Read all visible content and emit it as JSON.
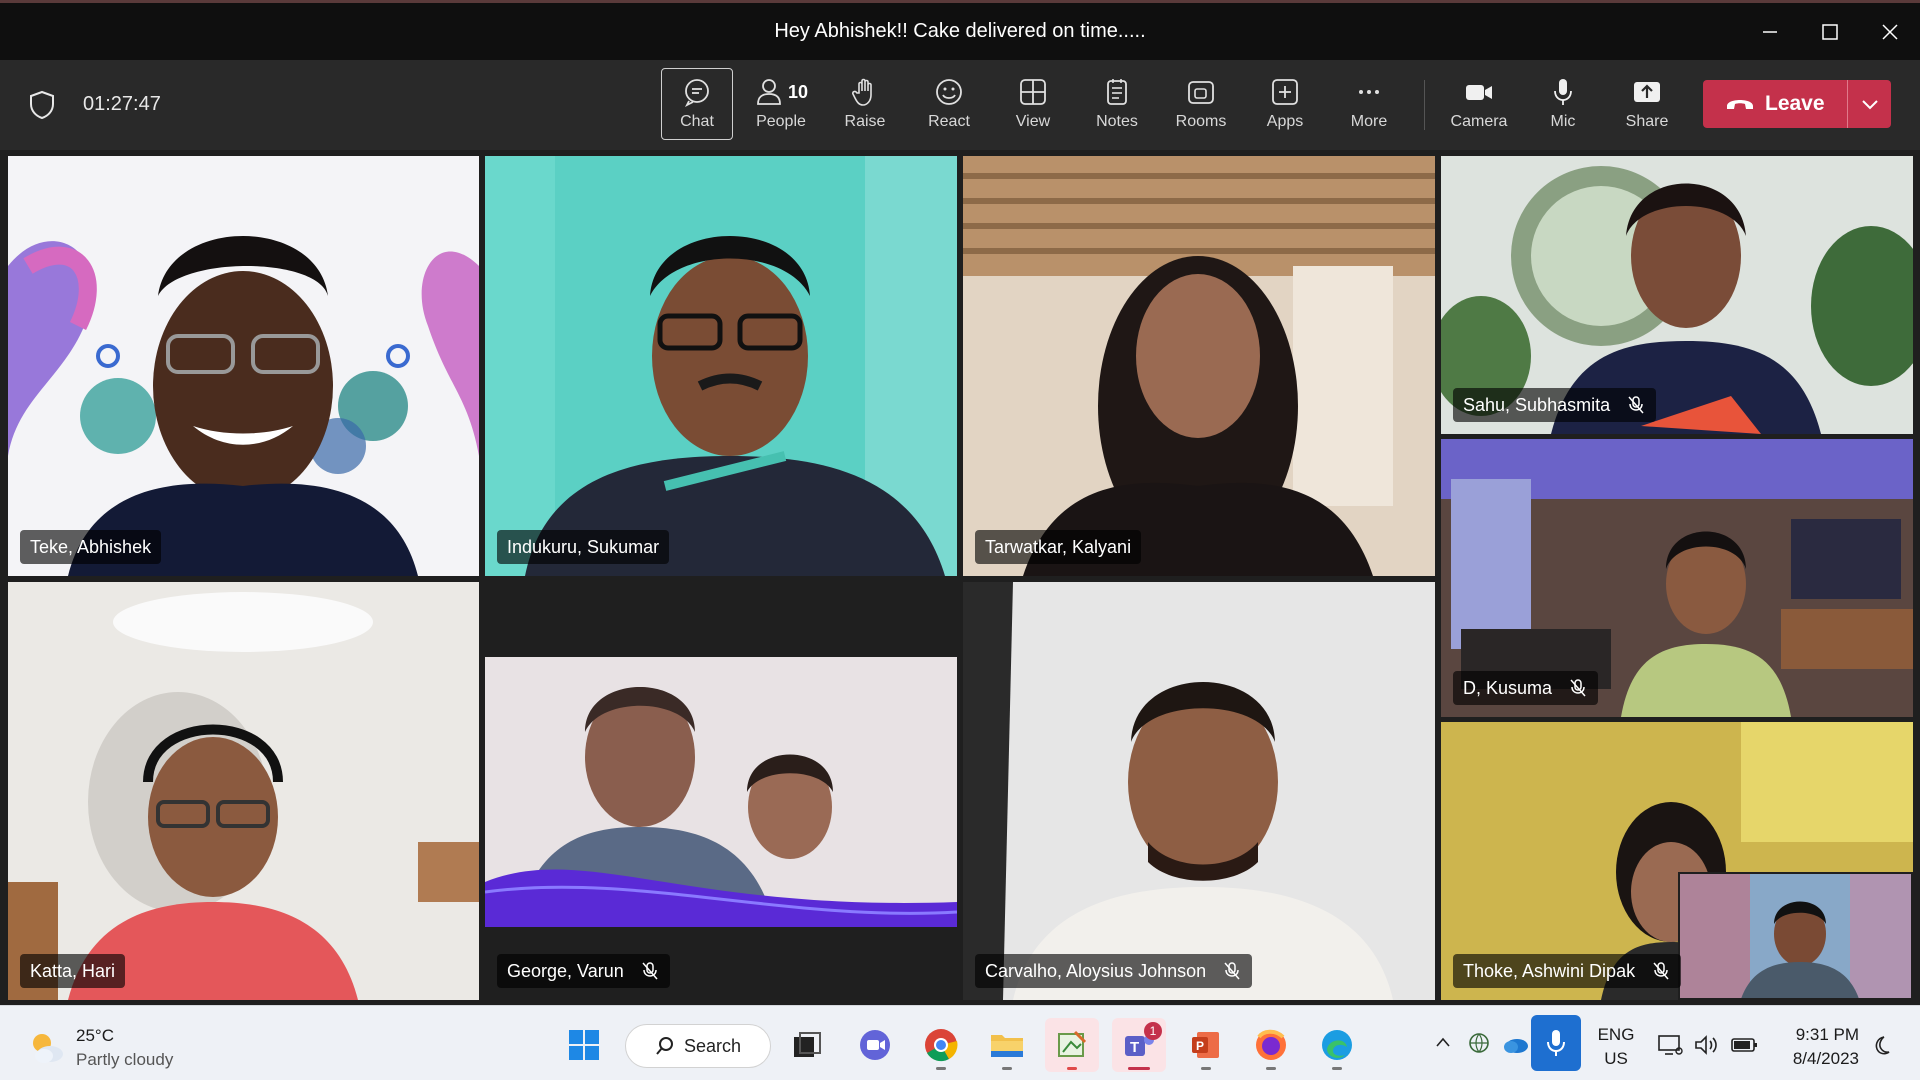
{
  "window": {
    "title": "Hey Abhishek!! Cake delivered on time.....",
    "controls": [
      "minimize-icon",
      "maximize-icon",
      "close-icon"
    ]
  },
  "toolbar": {
    "timer": "01:27:47",
    "tools": [
      {
        "label": "Chat",
        "icon": "chat-icon",
        "active": true
      },
      {
        "label": "People",
        "icon": "people-icon",
        "count": "10"
      },
      {
        "label": "Raise",
        "icon": "hand-icon"
      },
      {
        "label": "React",
        "icon": "smiley-icon"
      },
      {
        "label": "View",
        "icon": "grid-icon"
      },
      {
        "label": "Notes",
        "icon": "notes-icon"
      },
      {
        "label": "Rooms",
        "icon": "rooms-icon"
      },
      {
        "label": "Apps",
        "icon": "apps-icon"
      },
      {
        "label": "More",
        "icon": "more-icon"
      }
    ],
    "devices": [
      {
        "label": "Camera",
        "icon": "camera-icon"
      },
      {
        "label": "Mic",
        "icon": "mic-icon"
      },
      {
        "label": "Share",
        "icon": "share-icon"
      }
    ],
    "leave_label": "Leave",
    "leave_color": "#c4314b"
  },
  "participants": [
    {
      "name": "Teke, Abhishek",
      "muted": false
    },
    {
      "name": "Indukuru, Sukumar",
      "muted": false
    },
    {
      "name": "Tarwatkar, Kalyani",
      "muted": false
    },
    {
      "name": "Sahu, Subhasmita",
      "muted": true
    },
    {
      "name": "D, Kusuma",
      "muted": true
    },
    {
      "name": "Katta, Hari",
      "muted": false
    },
    {
      "name": "George, Varun",
      "muted": true
    },
    {
      "name": "Carvalho, Aloysius Johnson",
      "muted": true
    },
    {
      "name": "Thoke, Ashwini Dipak",
      "muted": true
    }
  ],
  "taskbar": {
    "weather_temp": "25°C",
    "weather_desc": "Partly cloudy",
    "search_label": "Search",
    "teams_badge": "1",
    "lang_line1": "ENG",
    "lang_line2": "US",
    "time": "9:31 PM",
    "date": "8/4/2023"
  }
}
